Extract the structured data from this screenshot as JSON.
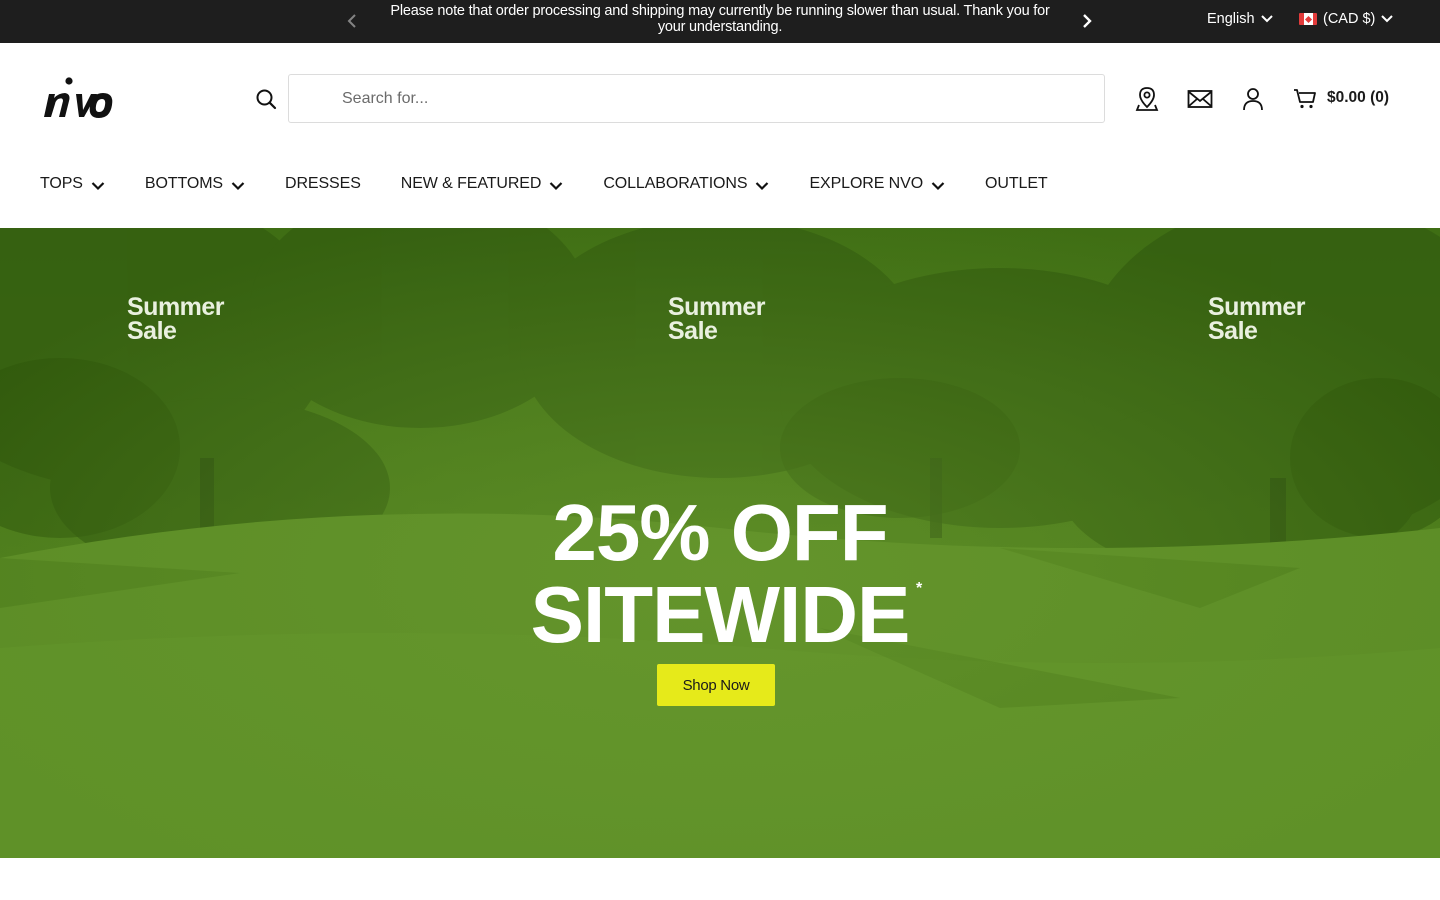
{
  "announcement": {
    "message": "Please note that order processing and shipping may currently be running slower than usual. Thank you for your understanding.",
    "prev_icon": "chevron-left-icon",
    "next_icon": "chevron-right-icon"
  },
  "locale": {
    "language": "English",
    "currency": "(CAD $)",
    "flag": "canada-flag-icon"
  },
  "header": {
    "logo_text": "nivo",
    "search": {
      "placeholder": "Search for..."
    },
    "icons": [
      "store-locator-icon",
      "mail-icon",
      "account-icon",
      "cart-icon"
    ],
    "cart_total": "$0.00 (0)"
  },
  "nav": {
    "items": [
      {
        "label": "TOPS",
        "dropdown": true
      },
      {
        "label": "BOTTOMS",
        "dropdown": true
      },
      {
        "label": "DRESSES",
        "dropdown": false
      },
      {
        "label": "NEW & FEATURED",
        "dropdown": true
      },
      {
        "label": "COLLABORATIONS",
        "dropdown": true
      },
      {
        "label": "EXPLORE NVO",
        "dropdown": true
      },
      {
        "label": "OUTLET",
        "dropdown": false
      }
    ]
  },
  "hero": {
    "summer_labels": [
      "Summer\nSale",
      "Summer\nSale",
      "Summer\nSale"
    ],
    "headline_line1": "25% OFF",
    "headline_line2": "SITEWIDE",
    "asterisk": "*",
    "cta": "Shop Now"
  },
  "colors": {
    "announcement_bg": "#1e1e1e",
    "hero_green": "#4f7f1d",
    "cta_yellow": "#e6ea1a"
  }
}
